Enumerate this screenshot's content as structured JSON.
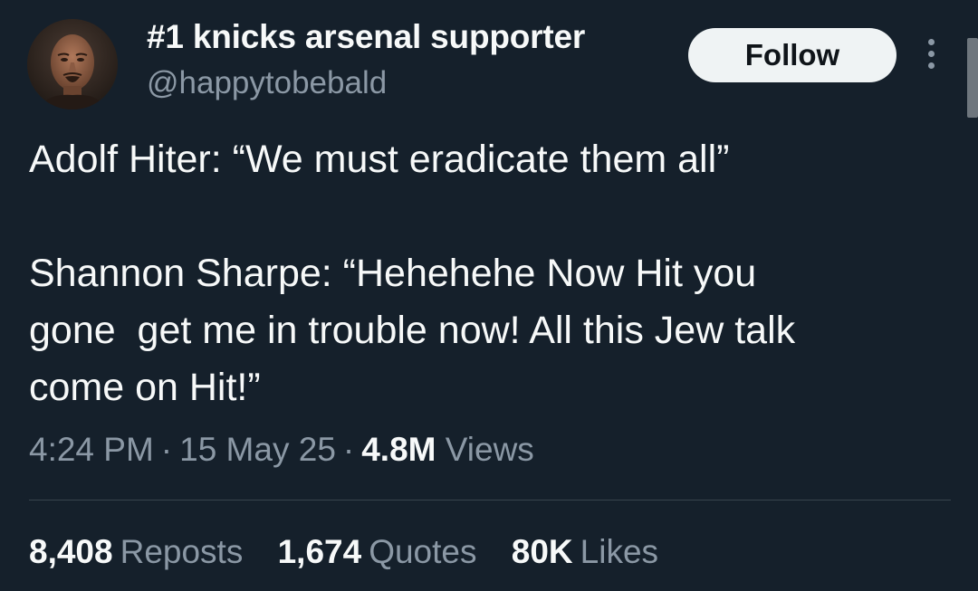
{
  "author": {
    "display_name": "#1 knicks arsenal supporter",
    "handle": "@happytobebald",
    "avatar_icon": "profile-photo"
  },
  "actions": {
    "follow_label": "Follow",
    "more_icon": "vertical-ellipsis-icon"
  },
  "tweet": {
    "line1": "Adolf Hiter: “We must eradicate them all”",
    "line2": "Shannon Sharpe: “Hehehehe Now Hit you",
    "line3": "gone  get me in trouble now! All this Jew talk",
    "line4": "come on Hit!”"
  },
  "meta": {
    "time": "4:24 PM",
    "date": "15 May 25",
    "views_count": "4.8M",
    "views_label": "Views",
    "separator": "·"
  },
  "stats": {
    "reposts_count": "8,408",
    "reposts_label": "Reposts",
    "quotes_count": "1,674",
    "quotes_label": "Quotes",
    "likes_count": "80K",
    "likes_label": "Likes"
  },
  "colors": {
    "background": "#15202b",
    "primary_text": "#f7f9f9",
    "secondary_text": "#8b98a5",
    "divider": "#38444d",
    "follow_button": "#eff3f4"
  }
}
